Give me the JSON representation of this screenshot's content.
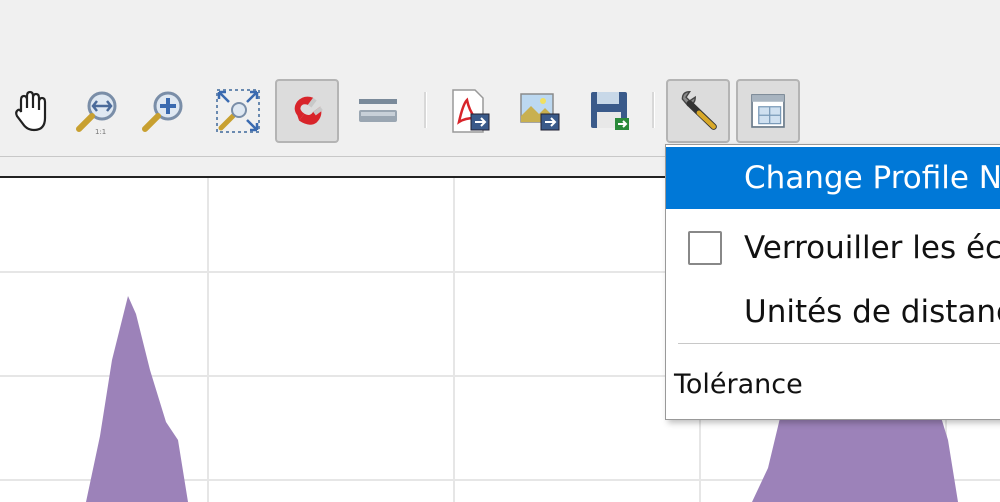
{
  "toolbar": {
    "buttons": [
      {
        "id": "pan",
        "icon": "hand-pan-icon"
      },
      {
        "id": "zoom-full",
        "icon": "zoom-full-extent-icon"
      },
      {
        "id": "zoom-in",
        "icon": "zoom-in-icon"
      },
      {
        "id": "reset-view",
        "icon": "reset-view-icon"
      },
      {
        "id": "snapping",
        "icon": "magnet-icon",
        "checked": true
      },
      {
        "id": "clear",
        "icon": "clear-layer-icon"
      },
      {
        "id": "export-pdf",
        "icon": "pdf-export-icon"
      },
      {
        "id": "export-image",
        "icon": "image-export-icon"
      },
      {
        "id": "export-3d",
        "icon": "save-disk-icon"
      },
      {
        "id": "options",
        "icon": "wrench-icon",
        "checked": true
      },
      {
        "id": "dock",
        "icon": "window-dock-icon",
        "checked": true
      }
    ]
  },
  "menu": {
    "items": [
      {
        "label": "Change Profile Na",
        "active": true
      },
      {
        "label": "Verrouiller les éch",
        "checkbox": true,
        "checked": false
      },
      {
        "label": "Unités de distanc"
      }
    ],
    "section_label": "Tolérance"
  },
  "colors": {
    "profile_fill": "#9c82b9",
    "menu_highlight": "#0078d7",
    "grid": "#e6e6e6"
  }
}
